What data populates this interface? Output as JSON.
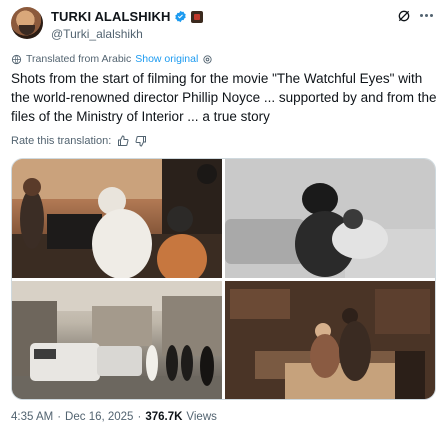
{
  "user": {
    "display_name": "TURKI ALALSHIKH",
    "handle": "@Turki_alalshikh"
  },
  "translation": {
    "label": "Translated from Arabic",
    "show_original": "Show original"
  },
  "tweet": {
    "text": "Shots from the start of filming for the movie \"The Watchful Eyes\" with the world-renowned director Phillip Noyce ... supported by and from the files of the Ministry of Interior ... a true story"
  },
  "rate": {
    "label": "Rate this translation:"
  },
  "footer": {
    "time": "4:35 AM",
    "separator1": "·",
    "date": "Dec 16, 2025",
    "separator2": "·",
    "views_count": "376.7K",
    "views_label": "Views"
  },
  "colors": {
    "link": "#1d9bf0",
    "verified": "#1d9bf0",
    "secondary_text": "#536471"
  },
  "icons": [
    "verified-badge-icon",
    "affiliate-badge-icon",
    "grok-icon",
    "more-icon",
    "globe-icon",
    "settings-icon",
    "thumbs-up-icon",
    "thumbs-down-icon"
  ]
}
